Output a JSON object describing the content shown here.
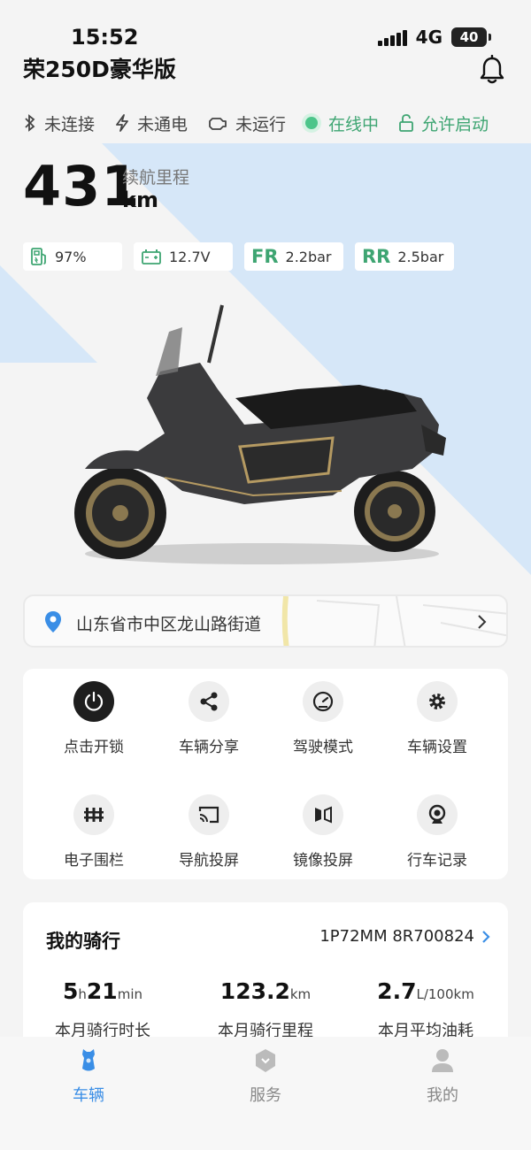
{
  "status_bar": {
    "time": "15:52",
    "network": "4G",
    "battery": "40"
  },
  "header": {
    "title": "荣250D豪华版"
  },
  "vehicle_status": [
    {
      "icon": "bluetooth-icon",
      "label": "未连接"
    },
    {
      "icon": "lightning-icon",
      "label": "未通电"
    },
    {
      "icon": "engine-icon",
      "label": "未运行"
    },
    {
      "icon": "online-dot-icon",
      "label": "在线中"
    },
    {
      "icon": "unlock-icon",
      "label": "允许启动"
    }
  ],
  "range": {
    "value": "431",
    "unit": "km",
    "label": "续航里程"
  },
  "chips": {
    "fuel": "97%",
    "battery_voltage": "12.7V",
    "front_tire_label": "FR",
    "front_tire": "2.2bar",
    "rear_tire_label": "RR",
    "rear_tire": "2.5bar"
  },
  "location": {
    "address": "山东省市中区龙山路街道"
  },
  "actions": [
    {
      "label": "点击开锁",
      "icon": "power-icon"
    },
    {
      "label": "车辆分享",
      "icon": "share-icon"
    },
    {
      "label": "驾驶模式",
      "icon": "gauge-icon"
    },
    {
      "label": "车辆设置",
      "icon": "gear-icon"
    },
    {
      "label": "电子围栏",
      "icon": "fence-icon"
    },
    {
      "label": "导航投屏",
      "icon": "cast-icon"
    },
    {
      "label": "镜像投屏",
      "icon": "mirror-icon"
    },
    {
      "label": "行车记录",
      "icon": "dashcam-icon"
    }
  ],
  "riding": {
    "title": "我的骑行",
    "vehicle_id": "1P72MM 8R700824",
    "duration_h": "5",
    "duration_h_unit": "h",
    "duration_m": "21",
    "duration_m_unit": "min",
    "duration_label": "本月骑行时长",
    "distance": "123.2",
    "distance_unit": "km",
    "distance_label": "本月骑行里程",
    "fuel_consumption": "2.7",
    "fuel_unit": "L/100km",
    "fuel_label": "本月平均油耗"
  },
  "tabs": [
    {
      "label": "车辆",
      "active": true
    },
    {
      "label": "服务",
      "active": false
    },
    {
      "label": "我的",
      "active": false
    }
  ],
  "colors": {
    "accent_green": "#3ea572",
    "accent_blue": "#3a8ee6",
    "bg_blue": "#d9e9fa"
  }
}
